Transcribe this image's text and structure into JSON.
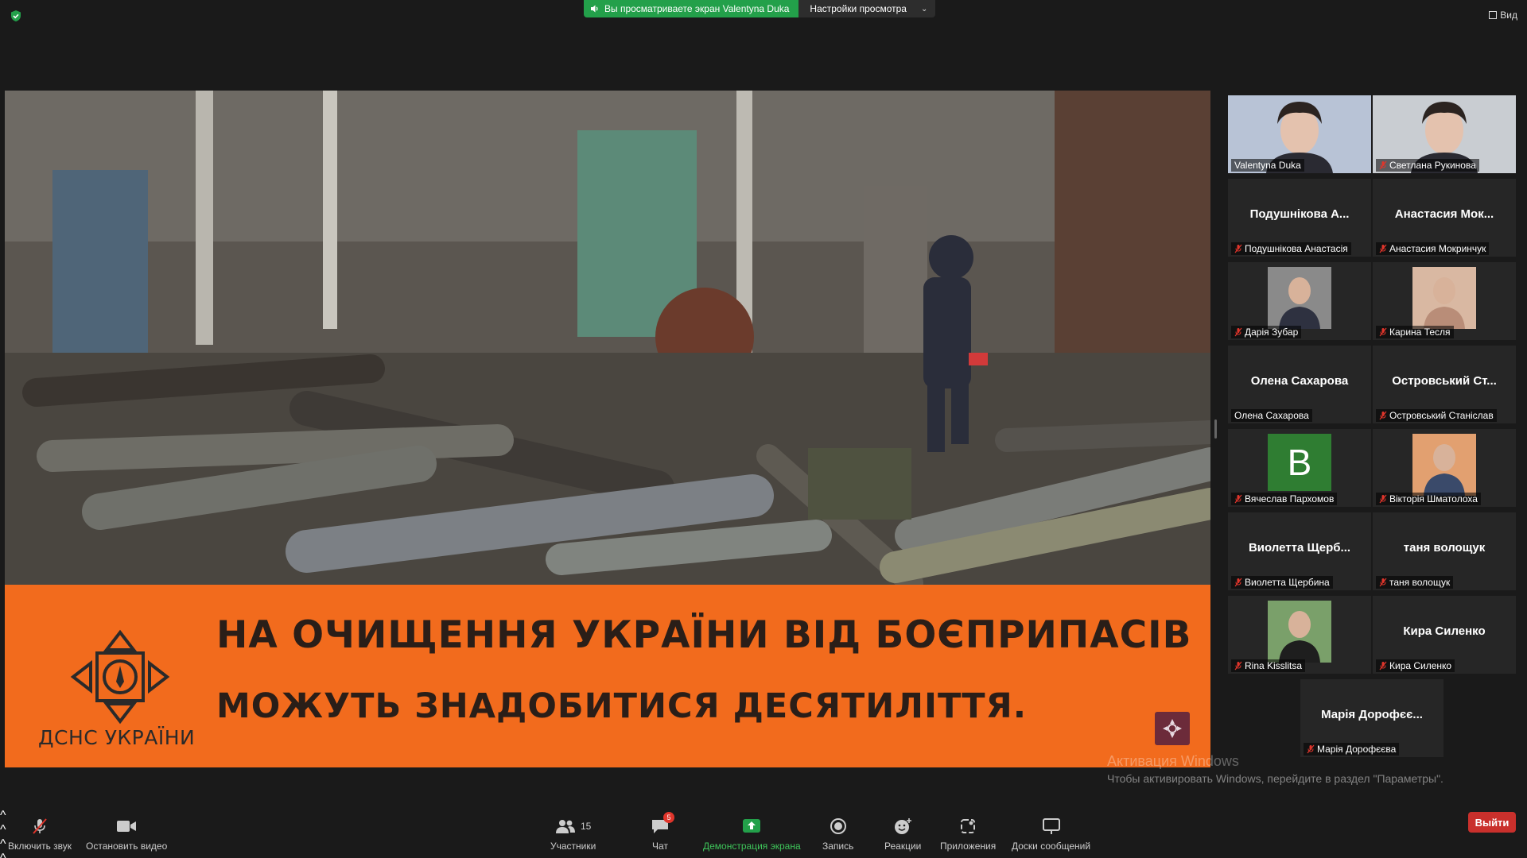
{
  "top": {
    "share_text": "Вы просматриваете экран Valentyna Duka",
    "view_settings": "Настройки просмотра",
    "view_button": "Вид"
  },
  "shared_screen": {
    "headline_line1": "НА ОЧИЩЕННЯ УКРАЇНИ ВІД БОЄПРИПАСІВ",
    "headline_line2": "МОЖУТЬ ЗНАДОБИТИСЯ ДЕСЯТИЛІТТЯ.",
    "org_name": "ДСНС УКРАЇНИ",
    "banner_color": "#f26b1d"
  },
  "gallery": [
    {
      "label": "Valentyna Duka",
      "big_name": "",
      "muted": false,
      "kind": "video",
      "active": true
    },
    {
      "label": "Светлана Рукинова",
      "big_name": "",
      "muted": true,
      "kind": "video",
      "active": false
    },
    {
      "label": "Подушнікова Анастасія",
      "big_name": "Подушнікова А...",
      "muted": true,
      "kind": "name",
      "active": false
    },
    {
      "label": "Анастасия Мокринчук",
      "big_name": "Анастасия Мок...",
      "muted": true,
      "kind": "name",
      "active": false
    },
    {
      "label": "Дарія Зубар",
      "big_name": "",
      "muted": true,
      "kind": "photo",
      "active": false
    },
    {
      "label": "Карина Тесля",
      "big_name": "",
      "muted": true,
      "kind": "photo",
      "active": false
    },
    {
      "label": "Олена Сахарова",
      "big_name": "Олена Сахарова",
      "muted": false,
      "kind": "name",
      "active": false
    },
    {
      "label": "Островський Станіслав",
      "big_name": "Островський Ст...",
      "muted": true,
      "kind": "name",
      "active": false
    },
    {
      "label": "Вячеслав Пархомов",
      "big_name": "",
      "muted": true,
      "kind": "letter",
      "letter": "B",
      "active": false
    },
    {
      "label": "Вікторія Шматолоха",
      "big_name": "",
      "muted": true,
      "kind": "photo",
      "active": false
    },
    {
      "label": "Виолетта Щербина",
      "big_name": "Виолетта Щерб...",
      "muted": true,
      "kind": "name",
      "active": false
    },
    {
      "label": "таня волощук",
      "big_name": "таня волощук",
      "muted": true,
      "kind": "name",
      "active": false
    },
    {
      "label": "Rina Kisslitsa",
      "big_name": "",
      "muted": true,
      "kind": "photo",
      "active": false
    },
    {
      "label": "Кира Силенко",
      "big_name": "Кира Силенко",
      "muted": true,
      "kind": "name",
      "active": false
    },
    {
      "label": "Марія Дорофєєва",
      "big_name": "Марія Дорофєє...",
      "muted": true,
      "kind": "name",
      "active": false
    }
  ],
  "watermark": {
    "line1": "Активация Windows",
    "line2": "Чтобы активировать Windows, перейдите в раздел \"Параметры\"."
  },
  "toolbar": {
    "unmute": "Включить звук",
    "video": "Остановить видео",
    "participants": "Участники",
    "participants_count": "15",
    "chat": "Чат",
    "chat_badge": "5",
    "share": "Демонстрация экрана",
    "record": "Запись",
    "reactions": "Реакции",
    "apps": "Приложения",
    "whiteboards": "Доски сообщений",
    "leave": "Выйти"
  }
}
